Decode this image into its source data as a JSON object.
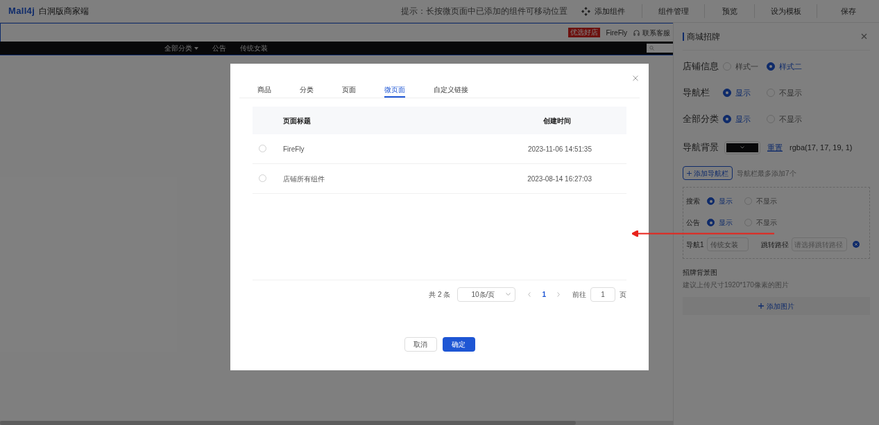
{
  "header": {
    "logo": "Mall4j",
    "title": "白洞版商家端",
    "hint": "提示：长按微页面中已添加的组件可移动位置",
    "add_component": "添加组件",
    "actions": [
      "组件管理",
      "预览",
      "设为模板",
      "保存"
    ]
  },
  "preview": {
    "badge": "优选好店",
    "shop_name": "FireFly",
    "contact": "联系客服",
    "nav_items": [
      {
        "label": "全部分类",
        "kind": "dropdown"
      },
      {
        "label": "公告",
        "kind": "link"
      },
      {
        "label": "传统女装",
        "kind": "link"
      }
    ]
  },
  "panel": {
    "title": "商城招牌",
    "options": [
      {
        "label": "店铺信息",
        "choices": [
          {
            "label": "样式一",
            "selected": false
          },
          {
            "label": "样式二",
            "selected": true
          }
        ]
      },
      {
        "label": "导航栏",
        "choices": [
          {
            "label": "显示",
            "selected": true
          },
          {
            "label": "不显示",
            "selected": false
          }
        ]
      },
      {
        "label": "全部分类",
        "choices": [
          {
            "label": "显示",
            "selected": true
          },
          {
            "label": "不显示",
            "selected": false
          }
        ]
      }
    ],
    "nav_bg": {
      "label": "导航背景",
      "color": "#111113",
      "reset": "重置",
      "value": "rgba(17, 17, 19, 1)"
    },
    "add_nav": {
      "button": "添加导航栏",
      "hint": "导航栏最多添加7个"
    },
    "nav_box": {
      "options": [
        {
          "label": "搜索",
          "choices": [
            {
              "label": "显示",
              "selected": true
            },
            {
              "label": "不显示",
              "selected": false
            }
          ]
        },
        {
          "label": "公告",
          "choices": [
            {
              "label": "显示",
              "selected": true
            },
            {
              "label": "不显示",
              "selected": false
            }
          ]
        }
      ],
      "item": {
        "label": "导航1",
        "value": "传统女装",
        "path_label": "跳转路径",
        "path_placeholder": "请选择跳转路径"
      }
    },
    "bg_image": {
      "title": "招牌背景图",
      "hint": "建议上传尺寸1920*170像素的图片",
      "button": "添加图片"
    }
  },
  "dialog": {
    "tabs": [
      {
        "label": "商品",
        "selected": false
      },
      {
        "label": "分类",
        "selected": false
      },
      {
        "label": "页面",
        "selected": false
      },
      {
        "label": "微页面",
        "selected": true
      },
      {
        "label": "自定义链接",
        "selected": false
      }
    ],
    "columns": [
      "页面标题",
      "创建时间"
    ],
    "rows": [
      {
        "selected": false,
        "title": "FireFly",
        "created": "2023-11-06 14:51:35"
      },
      {
        "selected": false,
        "title": "店铺所有组件",
        "created": "2023-08-14 16:27:03"
      }
    ],
    "pagination": {
      "total": "共 2 条",
      "page_size": "10条/页",
      "pages": [
        {
          "label": "1",
          "selected": true
        }
      ],
      "goto_label": "前往",
      "goto_value": "1",
      "goto_suffix": "页"
    },
    "cancel": "取消",
    "confirm": "确定"
  }
}
